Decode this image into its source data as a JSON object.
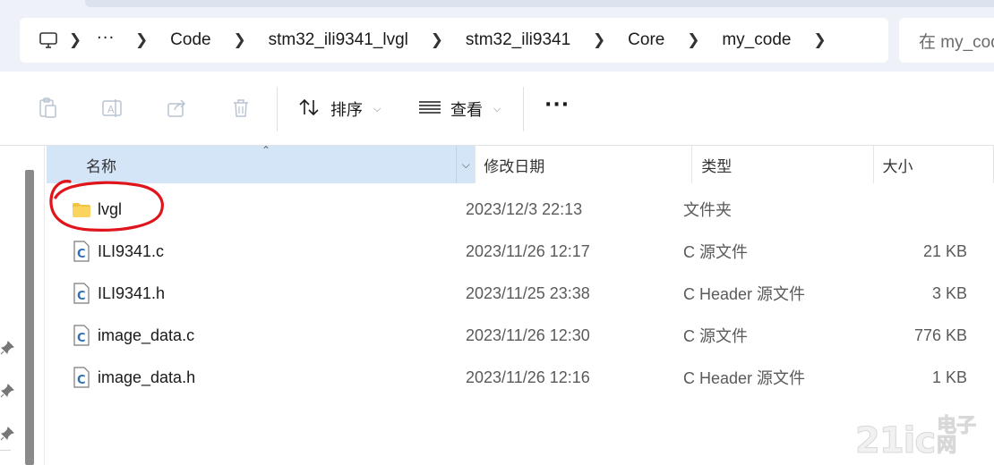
{
  "breadcrumb": {
    "ellipsis": "···",
    "items": [
      "Code",
      "stm32_ili9341_lvgl",
      "stm32_ili9341",
      "Core",
      "my_code"
    ]
  },
  "search": {
    "placeholder": "在 my_code 中搜索"
  },
  "toolbar": {
    "sort_label": "排序",
    "view_label": "查看",
    "more_label": "···"
  },
  "columns": {
    "name": "名称",
    "date": "修改日期",
    "type": "类型",
    "size": "大小"
  },
  "files": [
    {
      "name": "lvgl",
      "date": "2023/12/3 22:13",
      "type": "文件夹",
      "size": "",
      "icon": "folder-icon"
    },
    {
      "name": "ILI9341.c",
      "date": "2023/11/26 12:17",
      "type": "C 源文件",
      "size": "21 KB",
      "icon": "c-file-icon"
    },
    {
      "name": "ILI9341.h",
      "date": "2023/11/25 23:38",
      "type": "C Header 源文件",
      "size": "3 KB",
      "icon": "c-file-icon"
    },
    {
      "name": "image_data.c",
      "date": "2023/11/26 12:30",
      "type": "C 源文件",
      "size": "776 KB",
      "icon": "c-file-icon"
    },
    {
      "name": "image_data.h",
      "date": "2023/11/26 12:16",
      "type": "C Header 源文件",
      "size": "1 KB",
      "icon": "c-file-icon"
    }
  ],
  "watermark": {
    "brand": "21ic",
    "cn": "电子网"
  },
  "colors": {
    "header_selected": "#d3e5f7",
    "annotation_red": "#e0141b",
    "folder_yellow": "#f5c342",
    "c_file_blue": "#2e6fb5"
  }
}
